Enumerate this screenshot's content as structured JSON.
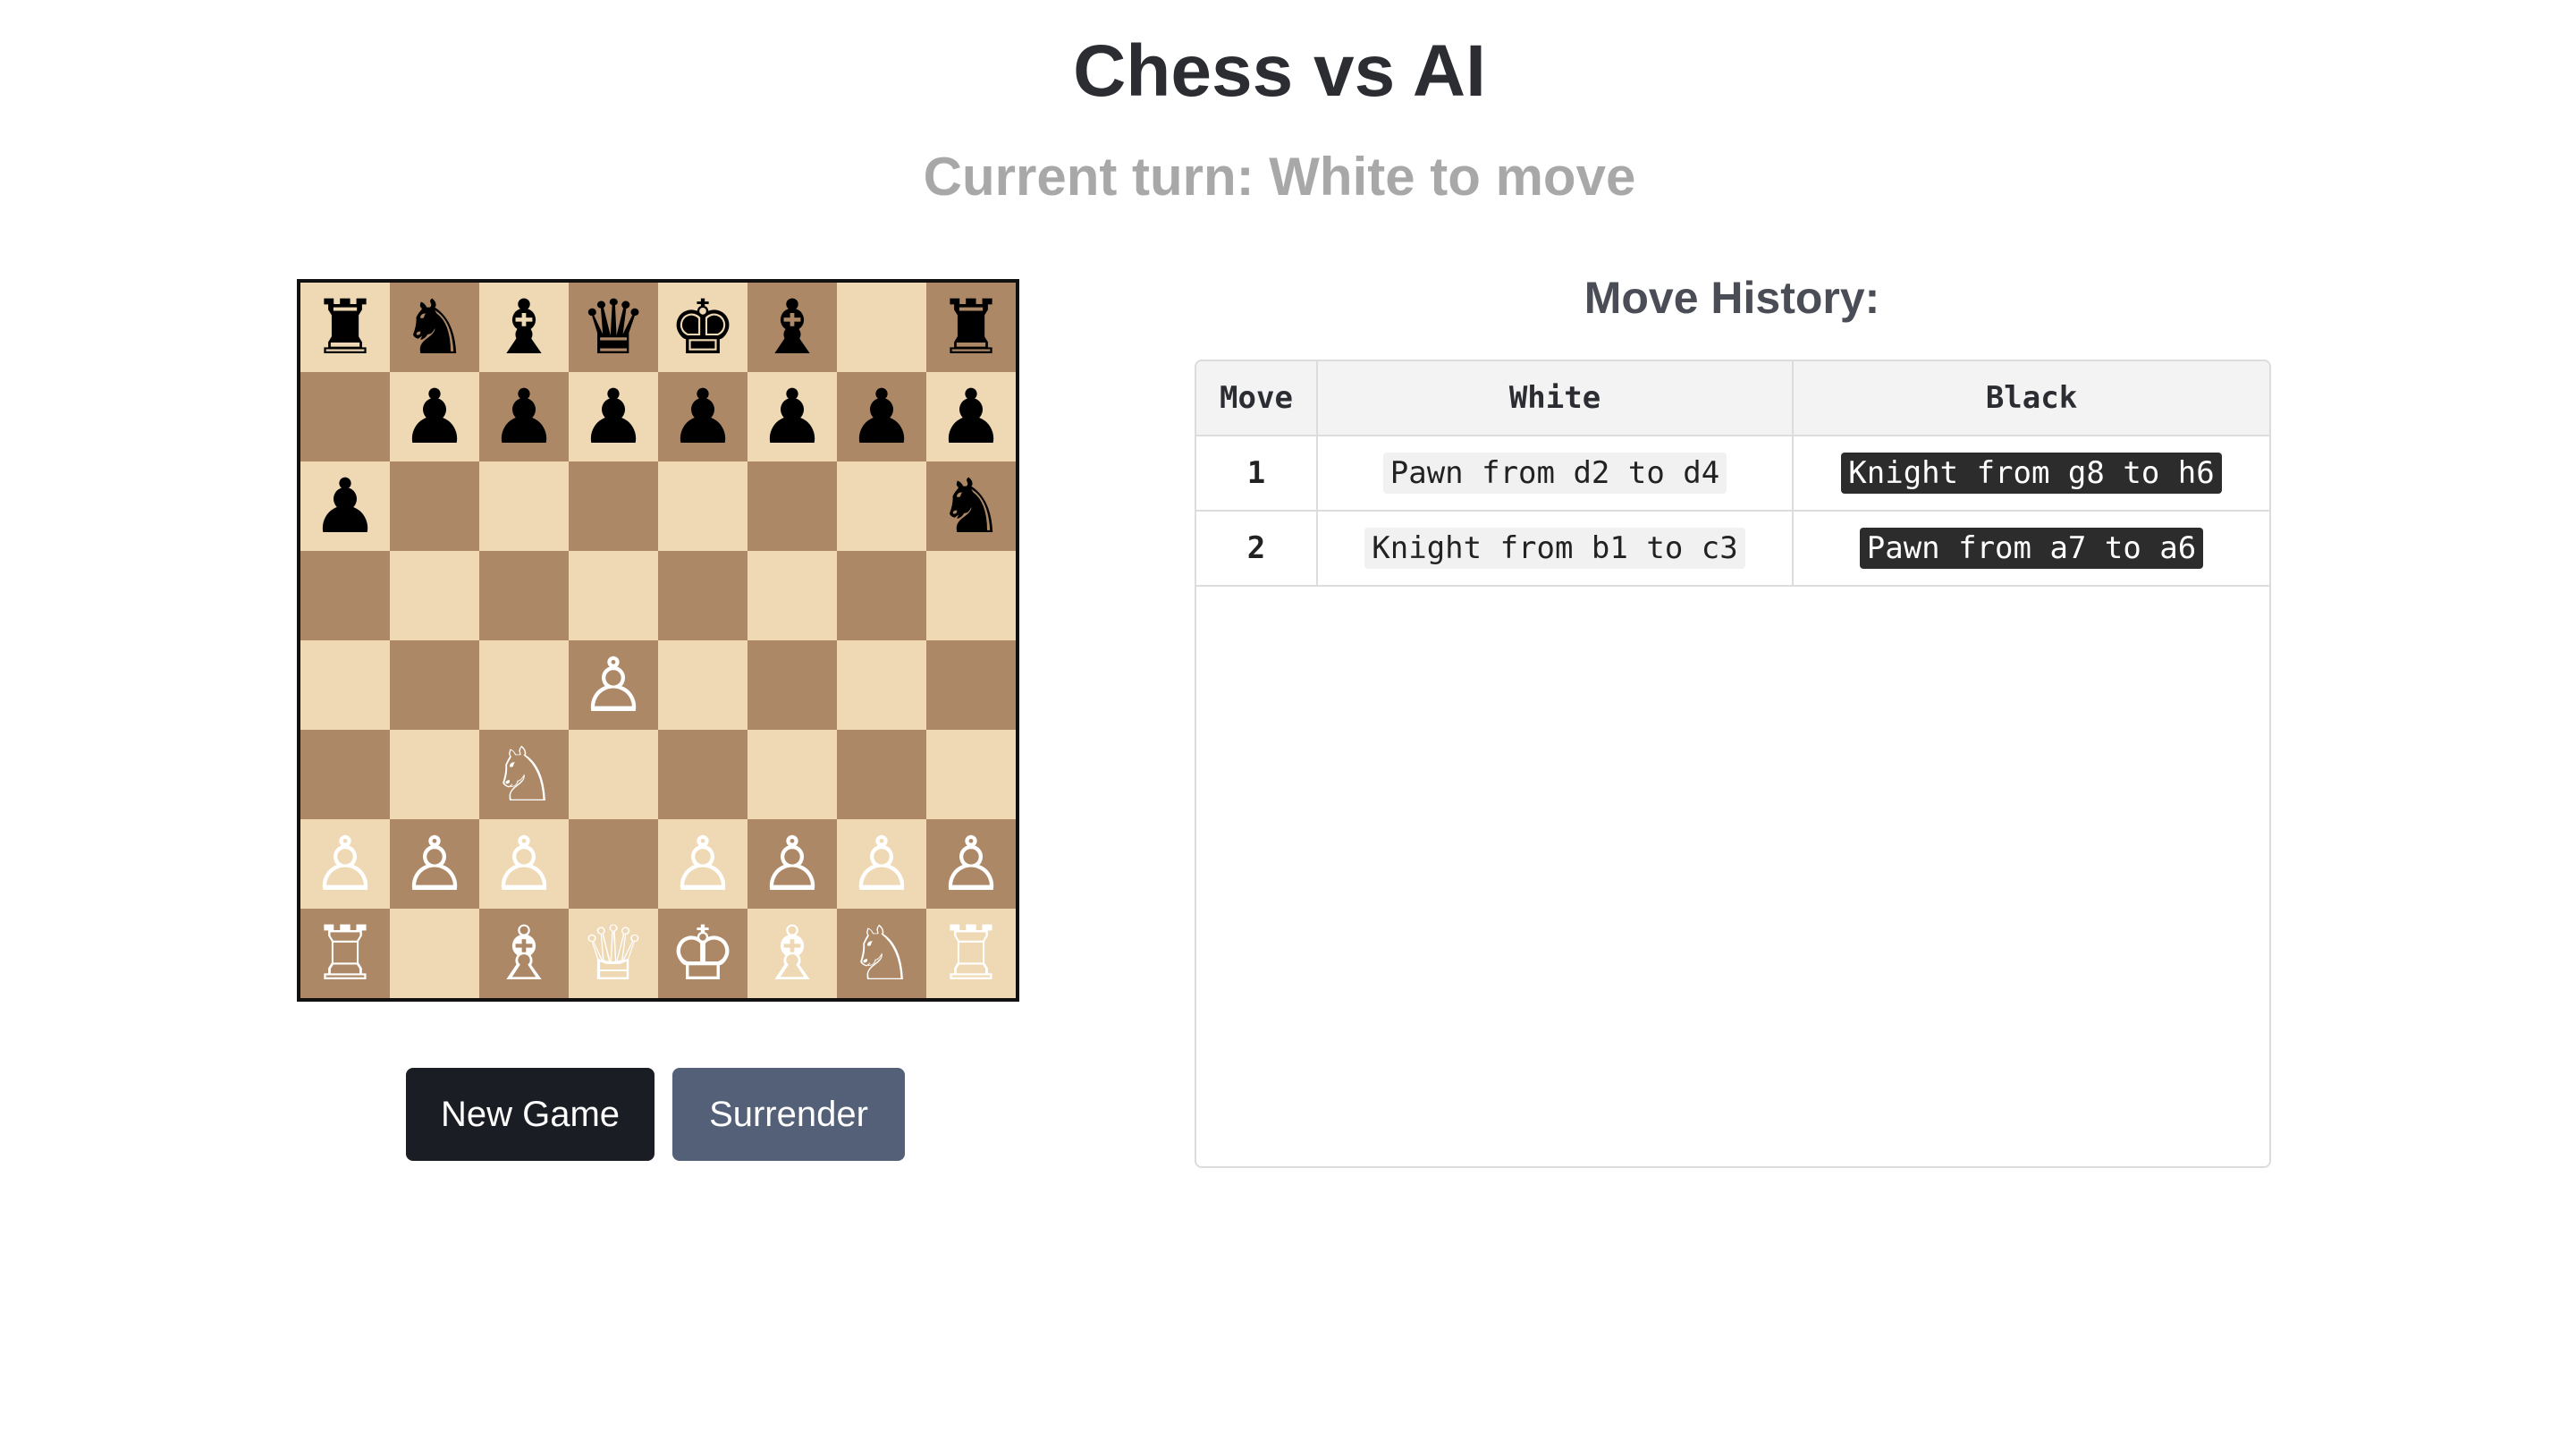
{
  "title": "Chess vs AI",
  "status": {
    "turn_text": "Current turn: White to move"
  },
  "board": {
    "orientation": "white-bottom",
    "light_square_color": "#efd9b5",
    "dark_square_color": "#ad8867",
    "ranks": [
      [
        "r",
        "n",
        "b",
        "q",
        "k",
        "b",
        "",
        "r"
      ],
      [
        "",
        "p",
        "p",
        "p",
        "p",
        "p",
        "p",
        "p"
      ],
      [
        "p",
        "",
        "",
        "",
        "",
        "",
        "",
        "n"
      ],
      [
        "",
        "",
        "",
        "",
        "",
        "",
        "",
        ""
      ],
      [
        "",
        "",
        "",
        "P",
        "",
        "",
        "",
        ""
      ],
      [
        "",
        "",
        "N",
        "",
        "",
        "",
        "",
        ""
      ],
      [
        "P",
        "P",
        "P",
        "",
        "P",
        "P",
        "P",
        "P"
      ],
      [
        "R",
        "",
        "B",
        "Q",
        "K",
        "B",
        "N",
        "R"
      ]
    ],
    "piece_glyphs": {
      "k": "♚",
      "q": "♛",
      "r": "♜",
      "b": "♝",
      "n": "♞",
      "p": "♟",
      "K": "♔",
      "Q": "♕",
      "R": "♖",
      "B": "♗",
      "N": "♘",
      "P": "♙"
    }
  },
  "buttons": {
    "new_game": "New Game",
    "surrender": "Surrender",
    "new_game_color": "#1a1d23",
    "surrender_color": "#546078"
  },
  "history": {
    "title": "Move History:",
    "headers": {
      "move": "Move",
      "white": "White",
      "black": "Black"
    },
    "rows": [
      {
        "move": "1",
        "white": "Pawn from d2 to d4",
        "black": "Knight from g8 to h6"
      },
      {
        "move": "2",
        "white": "Knight from b1 to c3",
        "black": "Pawn from a7 to a6"
      }
    ]
  }
}
